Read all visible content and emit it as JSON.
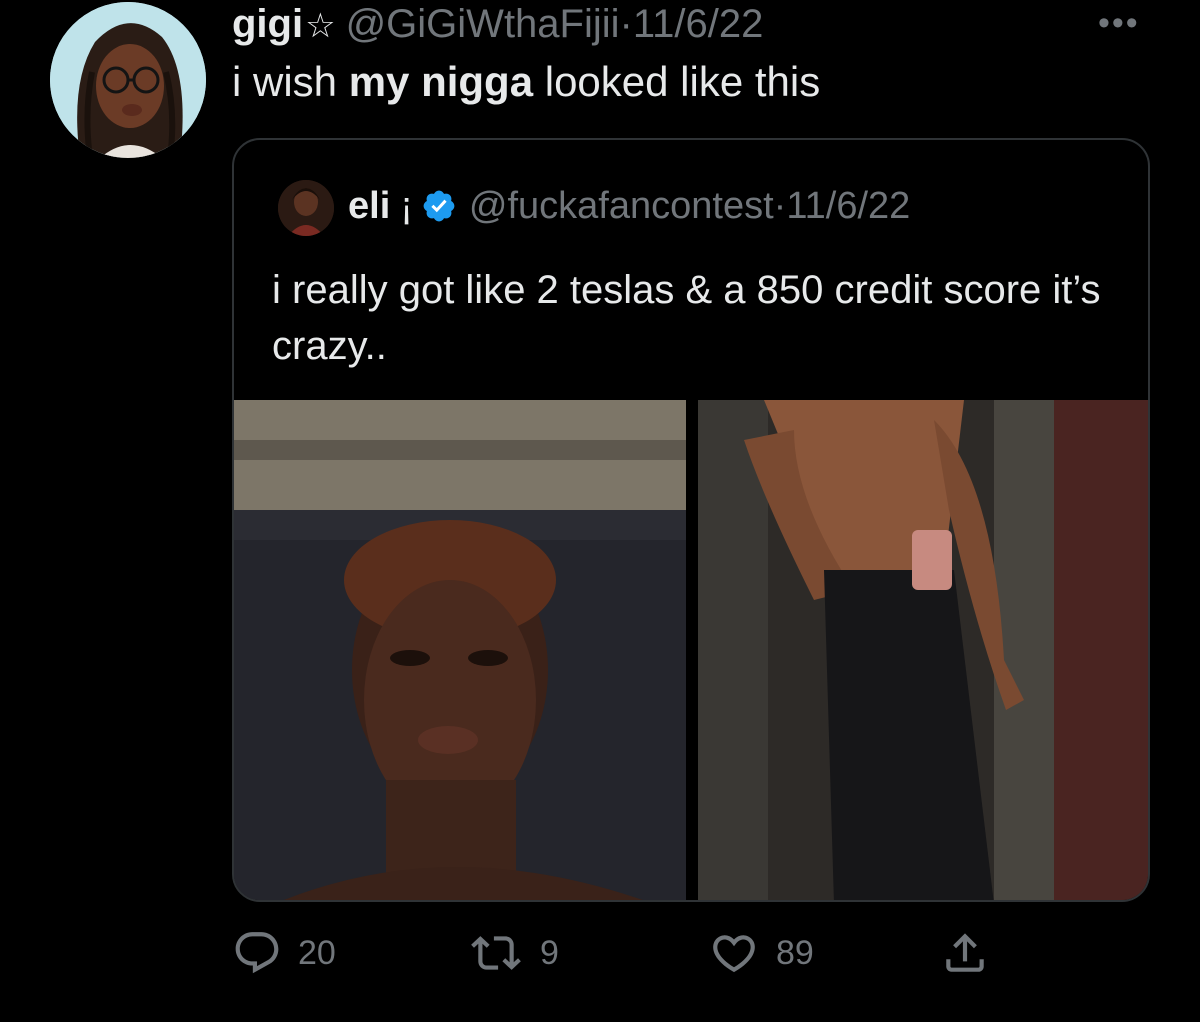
{
  "tweet": {
    "author_name": "gigi",
    "author_star": "☆",
    "handle": "@GiGiWthaFijii",
    "separator": "·",
    "date": "11/6/22",
    "more_label": "•••",
    "text_part1": "i wish ",
    "text_bold": "my nigga",
    "text_part2": " looked like this",
    "avatar_icon": "profile-photo-avatar"
  },
  "quoted": {
    "author_name": "eli",
    "author_suffix": "¡",
    "verified": true,
    "handle": "@fuckafancontest",
    "separator": "·",
    "date": "11/6/22",
    "text": "i really got like 2 teslas & a 850 credit score it’s crazy..",
    "media_count": 2
  },
  "actions": {
    "reply_count": "20",
    "retweet_count": "9",
    "like_count": "89",
    "reply_icon": "reply-icon",
    "retweet_icon": "retweet-icon",
    "like_icon": "heart-icon",
    "share_icon": "share-icon"
  },
  "colors": {
    "background": "#000000",
    "text_primary": "#e7e9ea",
    "text_secondary": "#71767b",
    "border": "#2f3336",
    "verified_blue": "#1d9bf0"
  }
}
